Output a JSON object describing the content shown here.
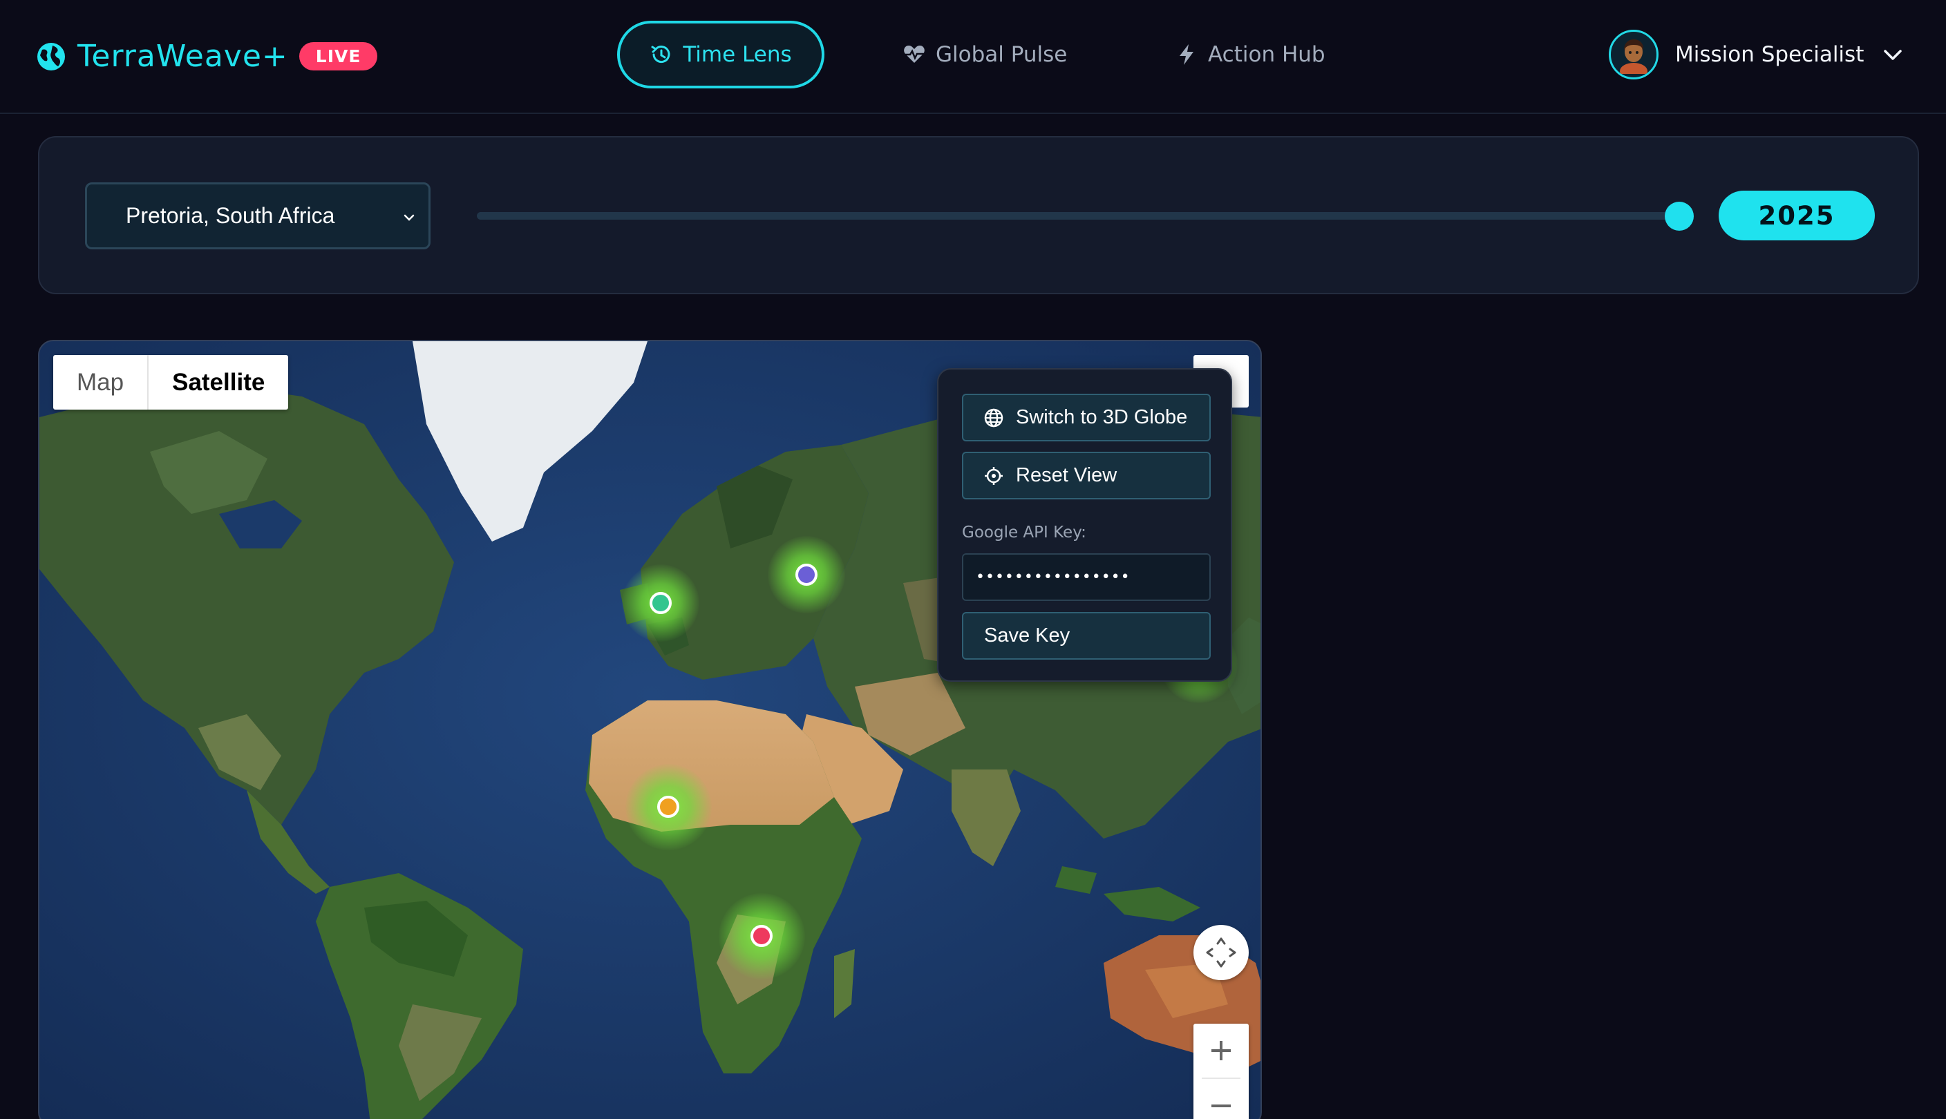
{
  "header": {
    "brand_name": "TerraWeave+",
    "live_badge": "LIVE",
    "nav": [
      {
        "label": "Time Lens",
        "active": true,
        "icon": "history-icon"
      },
      {
        "label": "Global Pulse",
        "active": false,
        "icon": "heart-pulse-icon"
      },
      {
        "label": "Action Hub",
        "active": false,
        "icon": "bolt-icon"
      }
    ],
    "user": {
      "name": "Mission Specialist",
      "avatar": "avatar"
    }
  },
  "time_control": {
    "location": "Pretoria, South Africa",
    "year": "2025",
    "slider_fraction": 0.97
  },
  "map": {
    "type_options": [
      "Map",
      "Satellite"
    ],
    "selected_type": "Satellite",
    "markers": [
      {
        "name": "marker-western-europe",
        "color": "#33c58f"
      },
      {
        "name": "marker-eastern-europe",
        "color": "#6b5fd6"
      },
      {
        "name": "marker-west-africa",
        "color": "#f0a020"
      },
      {
        "name": "marker-southern-africa",
        "color": "#ee3a5e"
      },
      {
        "name": "marker-east-asia",
        "color": "#33c5c0"
      }
    ],
    "controls": {
      "zoom_in": "+",
      "zoom_out": "−"
    }
  },
  "globe_panel": {
    "switch_label": "Switch to 3D Globe",
    "reset_label": "Reset View",
    "api_key_label": "Google API Key:",
    "api_key_value": "••••••••••••••••",
    "save_label": "Save Key"
  },
  "colors": {
    "accent": "#1fe2ee",
    "live": "#ff3b67",
    "background": "#0b0b18",
    "panel": "#141a2b"
  }
}
